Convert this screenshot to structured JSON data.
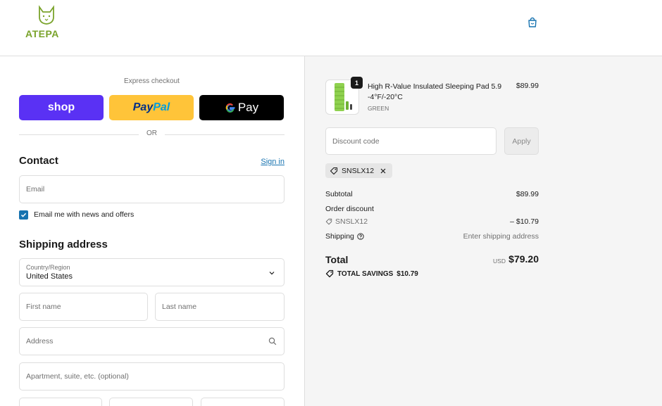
{
  "brand": {
    "name": "ATEPA",
    "color": "#7aa32b"
  },
  "header": {
    "cart_icon": "shopping-bag-icon"
  },
  "express": {
    "label": "Express checkout",
    "shop_label": "shop",
    "paypal_label_pay": "Pay",
    "paypal_label_pal": "Pal",
    "gpay_label": "Pay",
    "or_label": "OR"
  },
  "contact": {
    "title": "Contact",
    "signin_label": "Sign in",
    "email_placeholder": "Email",
    "newsletter_label": "Email me with news and offers",
    "newsletter_checked": true
  },
  "shipping": {
    "title": "Shipping address",
    "country_label": "Country/Region",
    "country_value": "United States",
    "first_name_placeholder": "First name",
    "last_name_placeholder": "Last name",
    "address_placeholder": "Address",
    "apartment_placeholder": "Apartment, suite, etc. (optional)"
  },
  "order": {
    "item": {
      "quantity": "1",
      "name": "High R-Value Insulated Sleeping Pad 5.9 -4°F/-20°C",
      "variant": "GREEN",
      "price": "$89.99"
    },
    "discount_placeholder": "Discount code",
    "apply_label": "Apply",
    "applied_code": "SNSLX12",
    "subtotal_label": "Subtotal",
    "subtotal_value": "$89.99",
    "order_discount_label": "Order discount",
    "discount_code_line": "SNSLX12",
    "discount_value": "– $10.79",
    "shipping_label": "Shipping",
    "shipping_value": "Enter shipping address",
    "total_label": "Total",
    "total_currency": "USD",
    "total_value": "$79.20",
    "savings_label": "TOTAL SAVINGS",
    "savings_value": "$10.79"
  },
  "colors": {
    "accent": "#1773b0",
    "shop_purple": "#5a31f4",
    "paypal_yellow": "#ffc439"
  }
}
